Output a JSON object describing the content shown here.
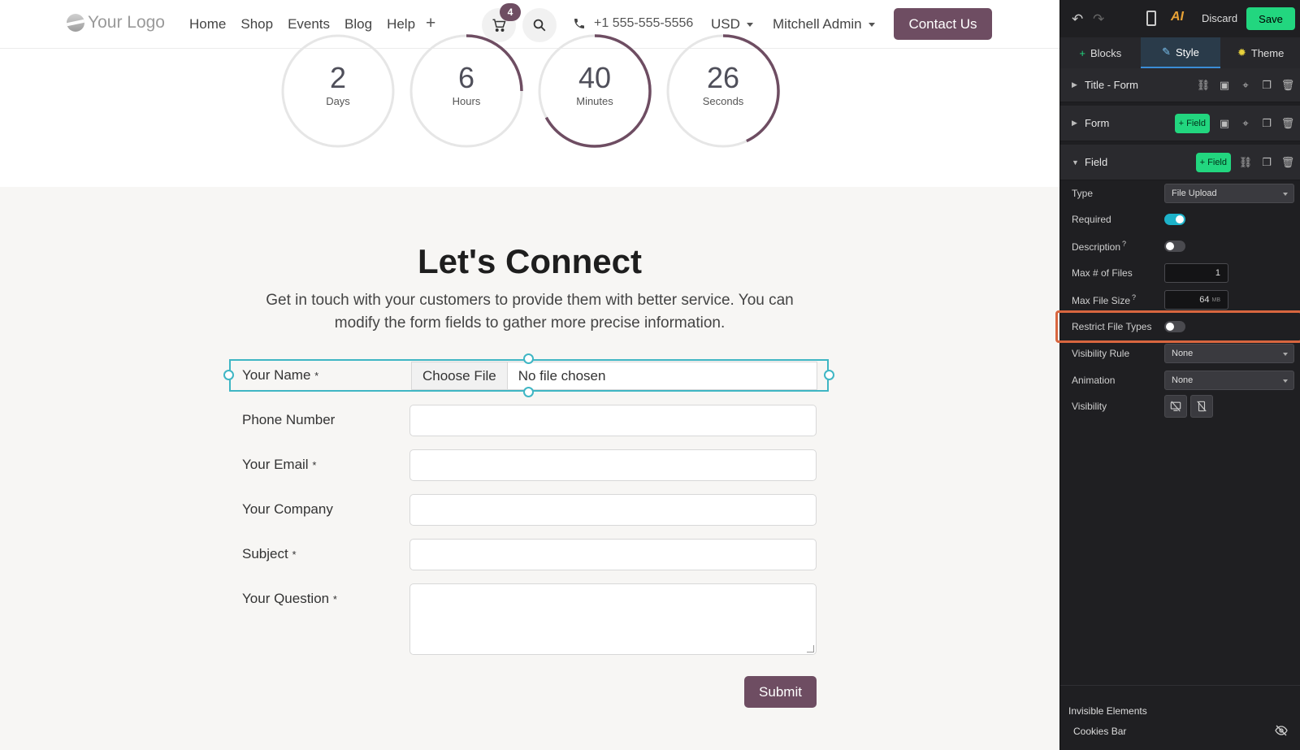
{
  "navbar": {
    "logo_text": "Your Logo",
    "menu": [
      "Home",
      "Shop",
      "Events",
      "Blog",
      "Help"
    ],
    "plus": "+",
    "cart_count": "4",
    "phone": "+1 555-555-5556",
    "currency": "USD",
    "user": "Mitchell Admin",
    "contact": "Contact Us",
    "brand_color": "#6e4d62"
  },
  "countdown": [
    {
      "value": "2",
      "label": "Days",
      "progress": 0.0
    },
    {
      "value": "6",
      "label": "Hours",
      "progress": 0.25
    },
    {
      "value": "40",
      "label": "Minutes",
      "progress": 0.67
    },
    {
      "value": "26",
      "label": "Seconds",
      "progress": 0.43
    }
  ],
  "connect": {
    "title": "Let's Connect",
    "description": "Get in touch with your customers to provide them with better service. You can modify the form fields to gather more precise information."
  },
  "form": {
    "selected_field": {
      "label": "Your Name",
      "required": "*",
      "button": "Choose File",
      "status": "No file chosen"
    },
    "fields": [
      {
        "label": "Phone Number",
        "required": ""
      },
      {
        "label": "Your Email",
        "required": "*"
      },
      {
        "label": "Your Company",
        "required": ""
      },
      {
        "label": "Subject",
        "required": "*"
      },
      {
        "label": "Your Question",
        "required": "*"
      }
    ],
    "submit": "Submit"
  },
  "editor": {
    "discard": "Discard",
    "save": "Save",
    "ai": "AI",
    "tabs": [
      {
        "label": "Blocks",
        "icon": "plus-icon"
      },
      {
        "label": "Style",
        "icon": "pencil-icon"
      },
      {
        "label": "Theme",
        "icon": "gear-icon"
      }
    ],
    "sections": {
      "title_form": "Title - Form",
      "form": "Form",
      "field": "Field",
      "add_field": "+ Field"
    },
    "options": {
      "type_label": "Type",
      "type_value": "File Upload",
      "required_label": "Required",
      "description_label": "Description",
      "description_help": "?",
      "max_files_label": "Max # of Files",
      "max_files_value": "1",
      "max_size_label": "Max File Size",
      "max_size_help": "?",
      "max_size_value": "64",
      "max_size_unit": "MB",
      "restrict_label": "Restrict File Types",
      "visibility_rule_label": "Visibility Rule",
      "visibility_rule_value": "None",
      "animation_label": "Animation",
      "animation_value": "None",
      "visibility_label": "Visibility"
    },
    "invisible_heading": "Invisible Elements",
    "invisible_items": [
      "Cookies Bar"
    ],
    "accent_save": "#22d67f",
    "accent_toggle": "#1db2c9",
    "highlight_color": "#d8663f"
  }
}
